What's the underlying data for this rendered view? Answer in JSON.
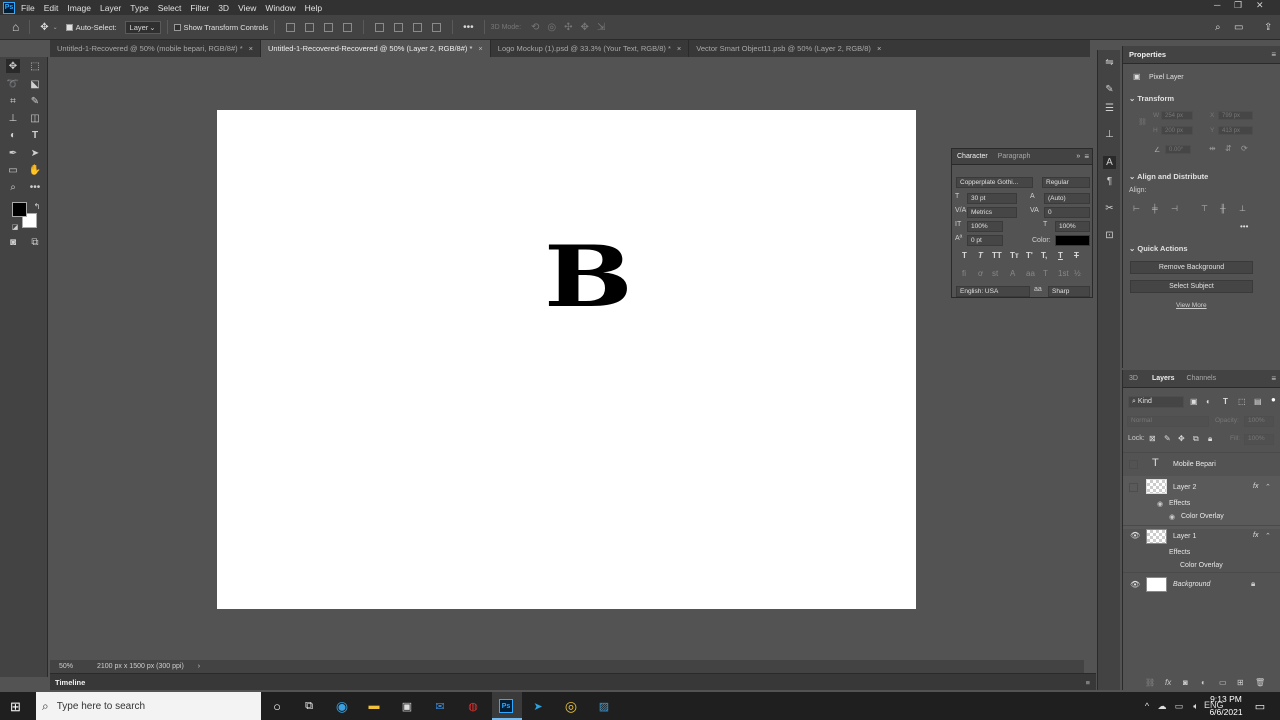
{
  "menu": {
    "app_icon": "Ps",
    "items": [
      "File",
      "Edit",
      "Image",
      "Layer",
      "Type",
      "Select",
      "Filter",
      "3D",
      "View",
      "Window",
      "Help"
    ]
  },
  "options": {
    "auto_select_label": "Auto-Select:",
    "auto_select_value": "Layer",
    "show_transform_label": "Show Transform Controls",
    "mode_3d_label": "3D Mode:"
  },
  "tabs": [
    {
      "label": "Untitled-1-Recovered @ 50% (mobile bepari, RGB/8#) *",
      "active": false
    },
    {
      "label": "Untitled-1-Recovered-Recovered @ 50% (Layer 2, RGB/8#) *",
      "active": true
    },
    {
      "label": "Logo Mockup (1).psd @ 33.3% (Your Text, RGB/8) *",
      "active": false
    },
    {
      "label": "Vector Smart Object11.psb @ 50% (Layer 2, RGB/8)",
      "active": false
    }
  ],
  "canvas": {
    "text": "B"
  },
  "status": {
    "zoom": "50%",
    "doc_info": "2100 px x 1500 px (300 ppi)"
  },
  "timeline": {
    "label": "Timeline"
  },
  "properties": {
    "title": "Properties",
    "layer_type": "Pixel Layer",
    "transform_label": "Transform",
    "w": "W",
    "w_val": "254 px",
    "x": "X",
    "x_val": "799 px",
    "h": "H",
    "h_val": "200 px",
    "y": "Y",
    "y_val": "413 px",
    "angle_val": "0.00°",
    "align_label": "Align and Distribute",
    "align_sub": "Align:",
    "quick_label": "Quick Actions",
    "remove_bg": "Remove Background",
    "select_subject": "Select Subject",
    "view_more": "View More"
  },
  "character": {
    "tab_char": "Character",
    "tab_para": "Paragraph",
    "font": "Copperplate Gothi...",
    "style": "Regular",
    "size": "30 pt",
    "leading": "(Auto)",
    "kerning": "Metrics",
    "tracking": "0",
    "vscale": "100%",
    "hscale": "100%",
    "baseline": "0 pt",
    "color_label": "Color:",
    "language": "English: USA",
    "aa_icon": "aa",
    "antialias": "Sharp"
  },
  "layers": {
    "tabs": [
      "3D",
      "Layers",
      "Channels"
    ],
    "kind": "Kind",
    "blend": "Normal",
    "opacity_label": "Opacity:",
    "opacity": "100%",
    "lock_label": "Lock:",
    "fill_label": "Fill:",
    "fill": "100%",
    "items": [
      {
        "name": "Mobile Bepari",
        "type": "text",
        "visible": false
      },
      {
        "name": "Layer 2",
        "type": "pixel",
        "visible": false,
        "fx": "fx",
        "effects": "Effects",
        "effect1": "Color Overlay"
      },
      {
        "name": "Layer 1",
        "type": "pixel",
        "visible": true,
        "fx": "fx",
        "effects": "Effects",
        "effect1": "Color Overlay"
      },
      {
        "name": "Background",
        "type": "background",
        "visible": true
      }
    ]
  },
  "taskbar": {
    "search_placeholder": "Type here to search",
    "time": "9:13 PM",
    "date": "6/6/2021"
  }
}
